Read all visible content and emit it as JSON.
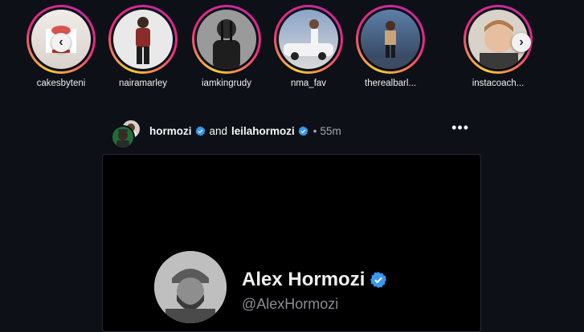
{
  "stories": [
    {
      "username": "cakesbyteni",
      "icon": "cake-photo"
    },
    {
      "username": "nairamarley",
      "icon": "person-photo"
    },
    {
      "username": "iamkingrudy",
      "icon": "person-photo"
    },
    {
      "username": "nma_fav",
      "icon": "car-photo"
    },
    {
      "username": "therealbarl...",
      "icon": "person-photo"
    },
    {
      "username": "instacoach...",
      "icon": "person-photo"
    }
  ],
  "nav": {
    "prev_icon": "chevron-left-icon",
    "next_icon": "chevron-right-icon",
    "prev_glyph": "‹",
    "next_glyph": "›"
  },
  "post": {
    "author1": "hormozi",
    "and_text": "and",
    "author2": "leilahormozi",
    "separator": "•",
    "time": "55m",
    "more_glyph": "•••",
    "card": {
      "name": "Alex Hormozi",
      "handle": "@AlexHormozi"
    }
  },
  "colors": {
    "background": "#0d1017",
    "verified": "#3897f0",
    "story_ring_start": "#f9ce34",
    "story_ring_mid": "#ee2a7b"
  }
}
